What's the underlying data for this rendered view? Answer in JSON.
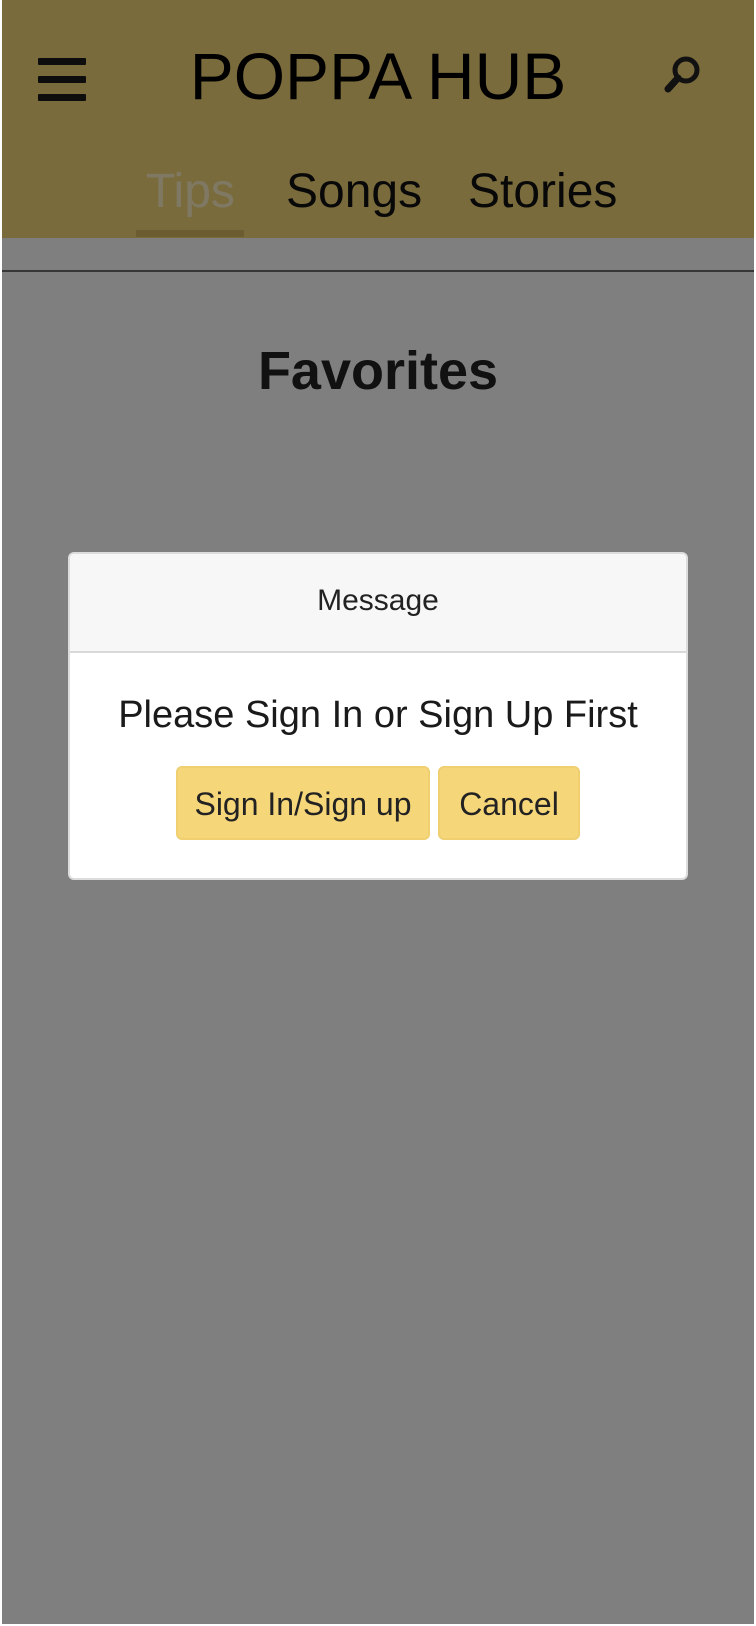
{
  "header": {
    "title": "POPPA HUB",
    "menu_icon": "hamburger-menu-icon",
    "search_icon": "search-icon"
  },
  "tabs": [
    {
      "label": "Tips",
      "active": true
    },
    {
      "label": "Songs",
      "active": false
    },
    {
      "label": "Stories",
      "active": false
    }
  ],
  "page": {
    "title": "Favorites"
  },
  "modal": {
    "title": "Message",
    "message": "Please Sign In or Sign Up First",
    "primary_button": "Sign In/Sign up",
    "secondary_button": "Cancel"
  },
  "colors": {
    "header_background": "#f5d679",
    "button_background": "#f5d679",
    "active_tab": "#fff3c9",
    "overlay": "rgba(0,0,0,0.5)"
  }
}
